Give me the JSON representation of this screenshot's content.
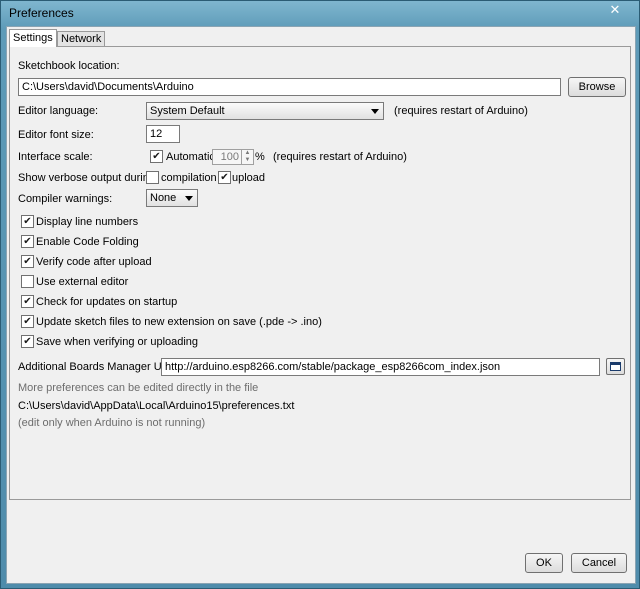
{
  "window": {
    "title": "Preferences",
    "close_glyph": "✕"
  },
  "tabs": [
    {
      "label": "Settings",
      "active": true
    },
    {
      "label": "Network",
      "active": false
    }
  ],
  "settings": {
    "sketchbook_label": "Sketchbook location:",
    "sketchbook_path": "C:\\Users\\david\\Documents\\Arduino",
    "browse_label": "Browse",
    "editor_language_label": "Editor language:",
    "editor_language_value": "System Default",
    "editor_language_note": "(requires restart of Arduino)",
    "font_size_label": "Editor font size:",
    "font_size_value": "12",
    "interface_scale_label": "Interface scale:",
    "automatic_label": "Automatic",
    "automatic_checked": true,
    "scale_value": "100",
    "scale_unit": "%",
    "scale_note": "(requires restart of Arduino)",
    "verbose_label": "Show verbose output during:",
    "compilation_label": "compilation",
    "compilation_checked": false,
    "upload_label": "upload",
    "upload_checked": true,
    "compiler_warnings_label": "Compiler warnings:",
    "compiler_warnings_value": "None",
    "options": [
      {
        "label": "Display line numbers",
        "checked": true
      },
      {
        "label": "Enable Code Folding",
        "checked": true
      },
      {
        "label": "Verify code after upload",
        "checked": true
      },
      {
        "label": "Use external editor",
        "checked": false
      },
      {
        "label": "Check for updates on startup",
        "checked": true
      },
      {
        "label": "Update sketch files to new extension on save (.pde -> .ino)",
        "checked": true
      },
      {
        "label": "Save when verifying or uploading",
        "checked": true
      }
    ],
    "boards_label": "Additional Boards Manager URLs:",
    "boards_value": "http://arduino.esp8266.com/stable/package_esp8266com_index.json",
    "more_prefs_note": "More preferences can be edited directly in the file",
    "prefs_path": "C:\\Users\\david\\AppData\\Local\\Arduino15\\preferences.txt",
    "edit_note": "(edit only when Arduino is not running)"
  },
  "footer": {
    "ok_label": "OK",
    "cancel_label": "Cancel"
  },
  "icons": {
    "check": "✔",
    "spin_up": "▲",
    "spin_down": "▼"
  }
}
